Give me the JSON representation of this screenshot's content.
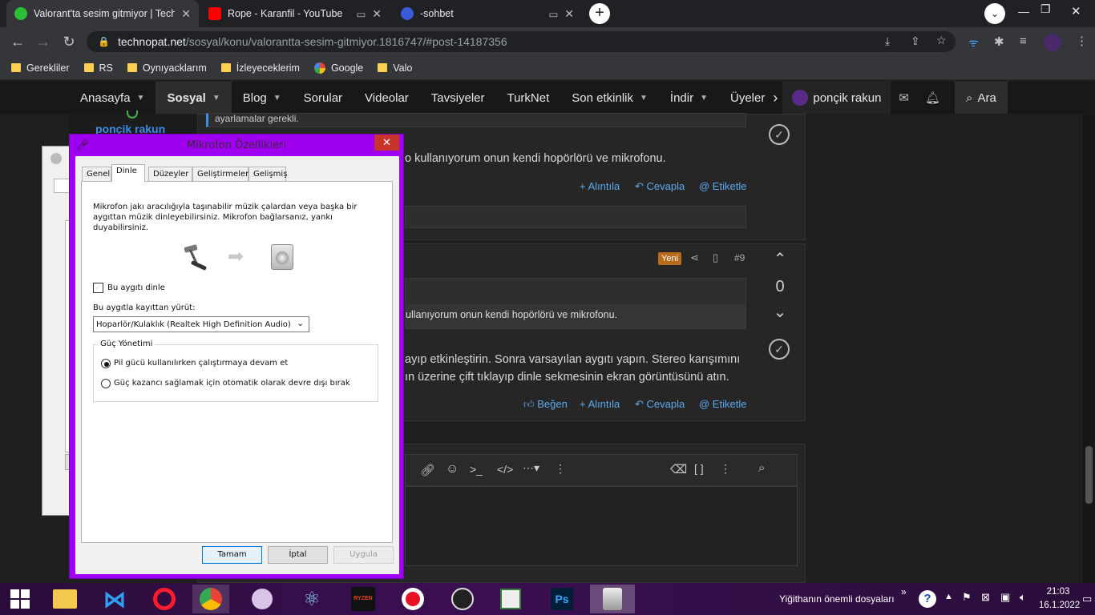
{
  "browser": {
    "tabs": [
      {
        "title": "Valorant'ta sesim gitmiyor | Techn",
        "active": true
      },
      {
        "title": "Rope - Karanfil - YouTube",
        "active": false
      },
      {
        "title": "-sohbet",
        "active": false
      }
    ],
    "url": {
      "host": "technopat.net",
      "path": "/sosyal/konu/valorantta-sesim-gitmiyor.1816747/#post-14187356"
    },
    "bookmarks": [
      "Gerekliler",
      "RS",
      "Oynıyacklarım",
      "İzleyeceklerim",
      "Google",
      "Valo"
    ]
  },
  "site": {
    "nav": [
      "Anasayfa",
      "Sosyal",
      "Blog",
      "Sorular",
      "Videolar",
      "Tavsiyeler",
      "TurkNet",
      "Son etkinlik",
      "İndir",
      "Üyeler"
    ],
    "user": "ponçik rakun",
    "search_label": "Ara"
  },
  "posts": {
    "sidebar_user": "ponçik rakun",
    "quote1": "ayarlamalar gerekli.",
    "text1": "o kullanıyorum onun kendi hopörlörü ve mikrofonu.",
    "actions1": {
      "quote": "+ Alıntıla",
      "reply": "Cevapla",
      "tag": "@ Etiketle"
    },
    "badge": "Yeni",
    "post_number": "#9",
    "vote_count": "0",
    "quote2": "ullanıyorum onun kendi hopörlörü ve mikrofonu.",
    "text2_line1": "ayıp etkinleştirin. Sonra varsayılan aygıtı yapın. Stereo karışımını",
    "text2_line2": "ın üzerine çift tıklayıp dinle sekmesinin ekran görüntüsünü atın.",
    "actions2": {
      "like": "Beğen",
      "quote": "+ Alıntıla",
      "reply": "Cevapla",
      "tag": "@ Etiketle"
    }
  },
  "dialog": {
    "title": "Mikrofon Özellikleri",
    "tabs": [
      "Genel",
      "Dinle",
      "Düzeyler",
      "Geliştirmeler",
      "Gelişmiş"
    ],
    "description": "Mikrofon jakı aracılığıyla taşınabilir müzik çalardan veya başka bir aygıttan müzik dinleyebilirsiniz. Mikrofon bağlarsanız, yankı duyabilirsiniz.",
    "listen_checkbox": "Bu aygıtı dinle",
    "playback_label": "Bu aygıtla kayıttan yürüt:",
    "playback_device": "Hoparlör/Kulaklık (Realtek High Definition Audio)",
    "power_group": "Güç Yönetimi",
    "power_opt1": "Pil gücü kullanılırken çalıştırmaya devam et",
    "power_opt2": "Güç kazancı sağlamak için otomatik olarak devre dışı bırak",
    "buttons": {
      "ok": "Tamam",
      "cancel": "İptal",
      "apply": "Uygula"
    }
  },
  "taskbar": {
    "toolbar_label": "Yiğithanın önemli dosyaları",
    "time": "21:03",
    "date": "16.1.2022"
  },
  "colors": {
    "accent_purple": "#a000f0",
    "link_blue": "#5ea9ee",
    "badge_orange": "#b86b1b"
  }
}
